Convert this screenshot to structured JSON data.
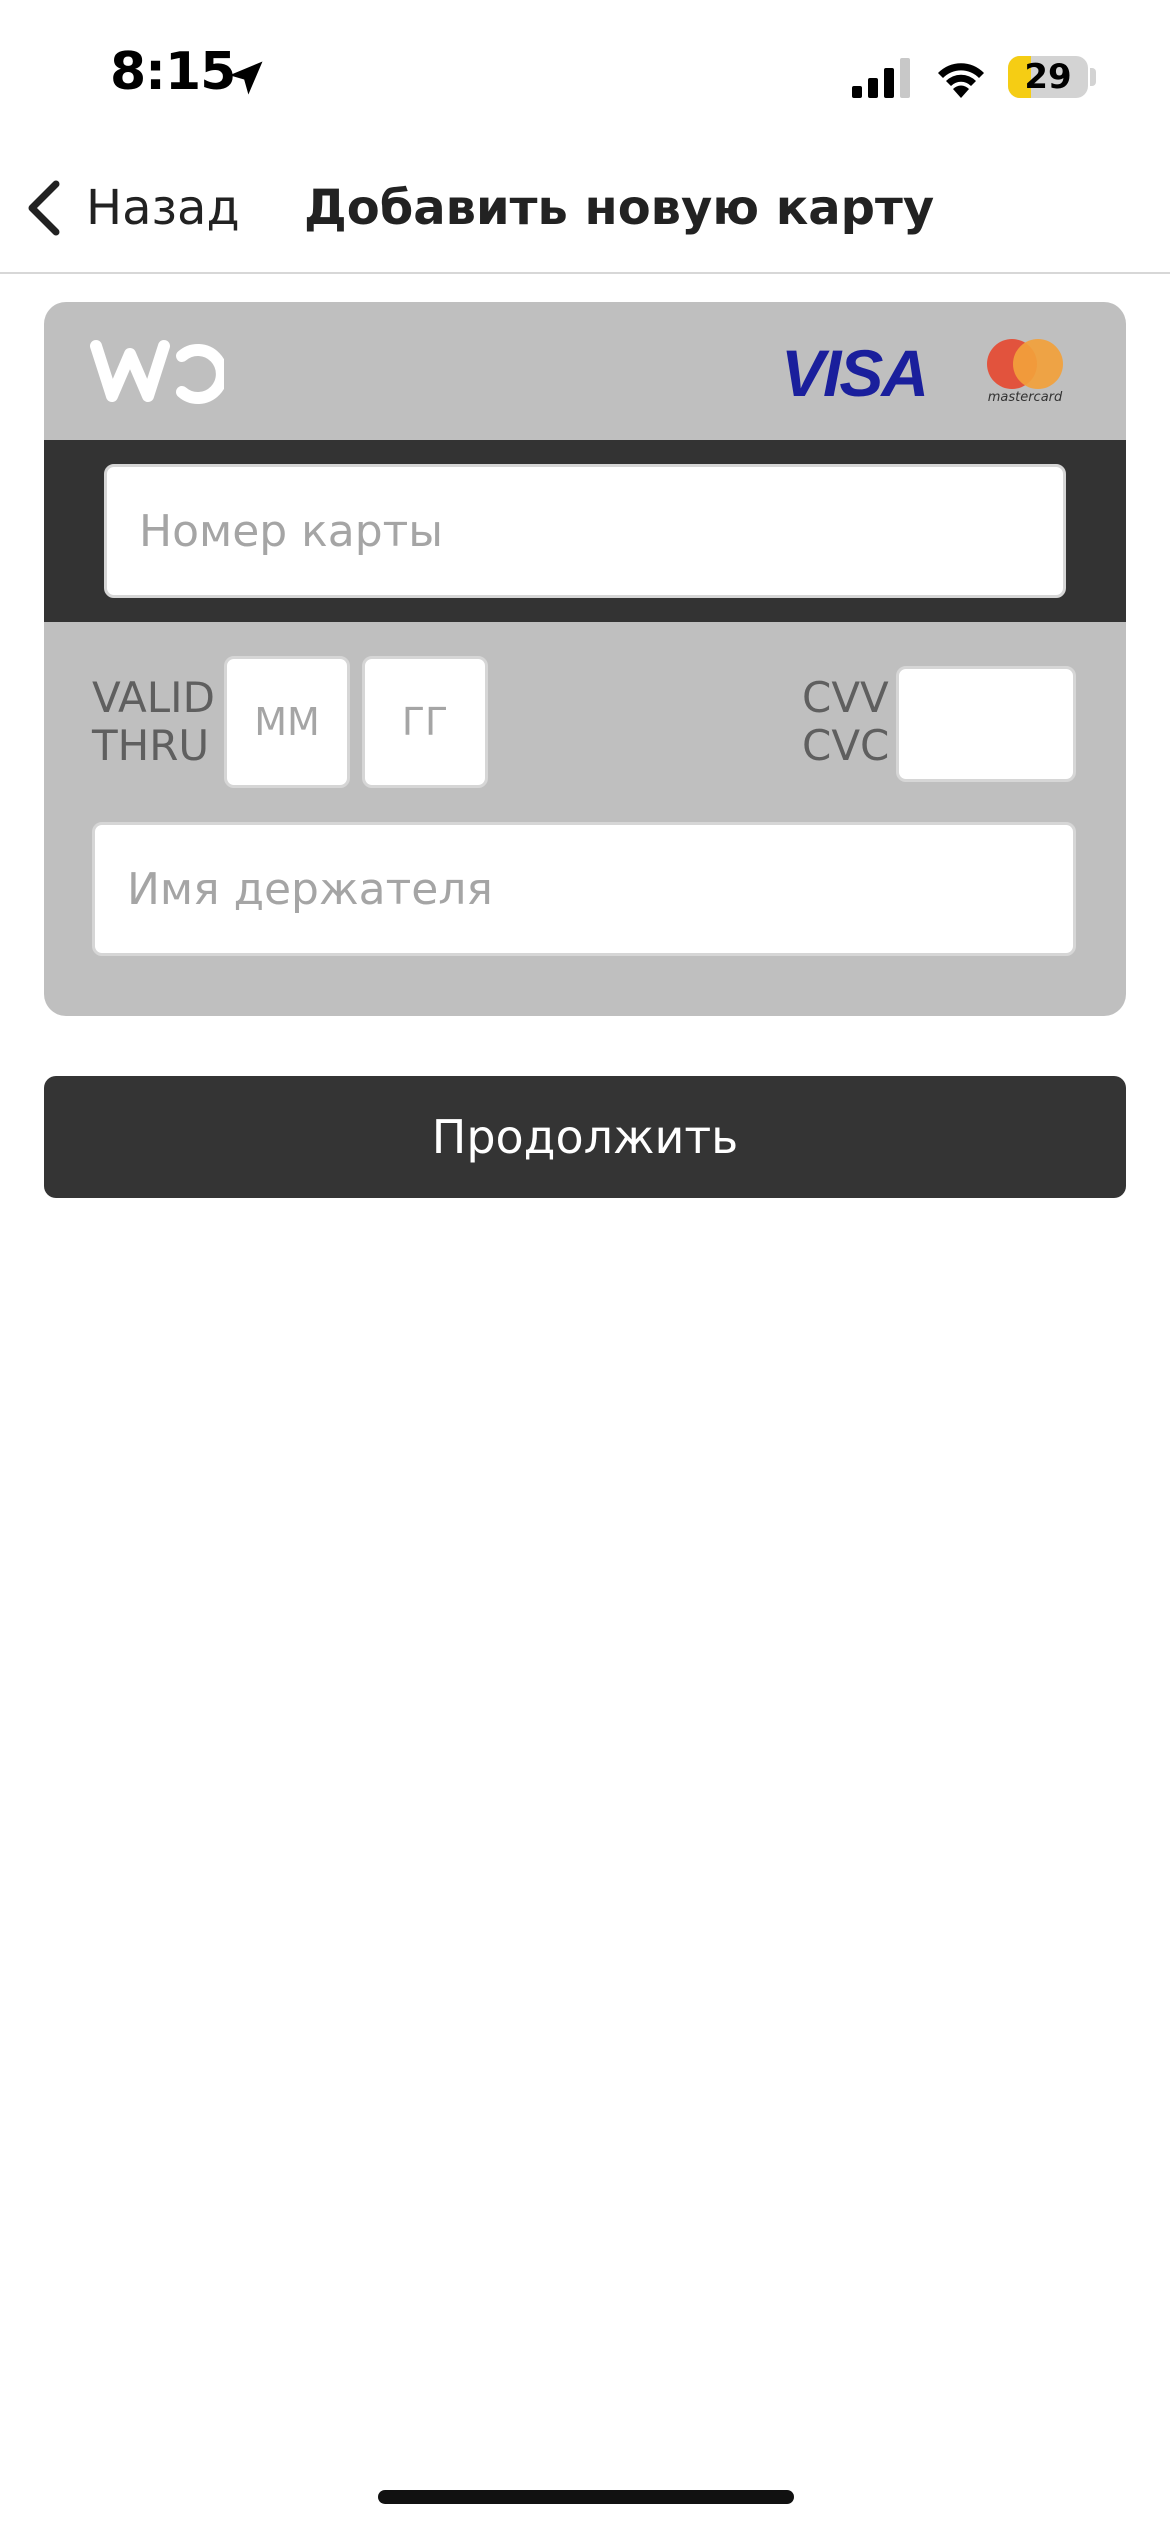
{
  "status_bar": {
    "time": "8:15",
    "battery_level": "29",
    "battery_fill_fraction": 0.29,
    "icons": [
      "location-arrow-icon",
      "cellular-signal-icon",
      "wifi-icon",
      "battery-icon"
    ],
    "colors": {
      "battery_fill": "#f5cd14"
    }
  },
  "nav": {
    "back_label": "Назад",
    "title": "Добавить новую карту"
  },
  "card_form": {
    "brand_logo": "wo-logo",
    "payment_logos": [
      "visa-logo",
      "mastercard-logo"
    ],
    "visa_text": "VISA",
    "mastercard_text": "mastercard",
    "card_number_placeholder": "Номер карты",
    "valid_thru_line1": "VALID",
    "valid_thru_line2": "THRU",
    "month_placeholder": "ММ",
    "year_placeholder": "ГГ",
    "cvv_line1": "CVV",
    "cvv_line2": "CVC",
    "cvv_value": "",
    "holder_name_placeholder": "Имя держателя"
  },
  "actions": {
    "continue_label": "Продолжить"
  },
  "colors": {
    "card_background": "#bfbfbf",
    "card_stripe": "#333333",
    "button_background": "#343434",
    "visa_blue": "#1a1f9c",
    "mastercard_red": "#eb001b",
    "mastercard_orange": "#f79e1b"
  }
}
